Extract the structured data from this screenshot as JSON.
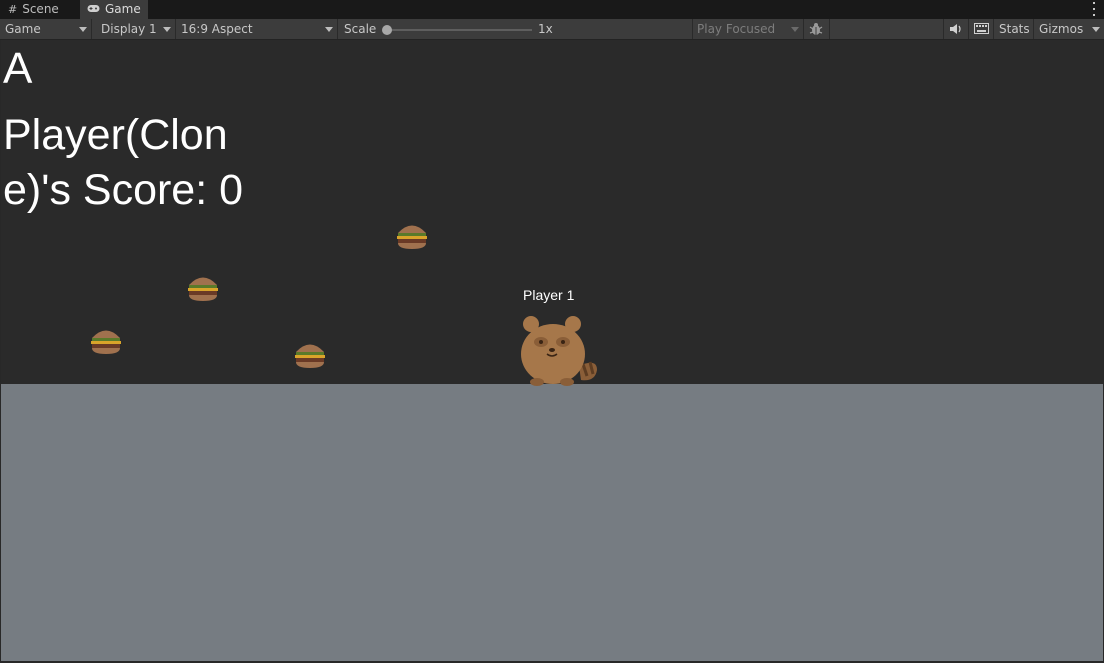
{
  "tabs": [
    {
      "label": "Scene",
      "icon": "grid-icon"
    },
    {
      "label": "Game",
      "icon": "gamepad-icon"
    }
  ],
  "toolbar": {
    "view_mode": "Game",
    "display": "Display 1",
    "aspect": "16:9 Aspect",
    "scale_label": "Scale",
    "scale_value": "1x",
    "play_mode": "Play Focused",
    "stats": "Stats",
    "gizmos": "Gizmos"
  },
  "game": {
    "key_hint": "A",
    "score_text": "Player(Clone)'s Score: 0",
    "player_label": "Player 1",
    "colors": {
      "background": "#2a2a2a",
      "ground": "#767c82",
      "player": "#a6774a"
    }
  }
}
